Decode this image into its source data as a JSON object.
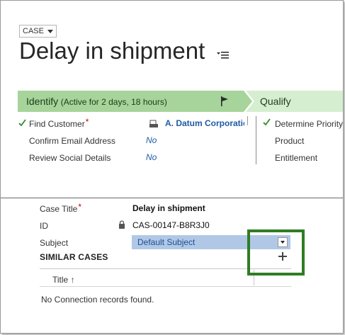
{
  "header": {
    "entity_label": "CASE",
    "title": "Delay in shipment"
  },
  "process": {
    "active_stage": "Identify",
    "active_note": "(Active for 2 days, 18 hours)",
    "next_stage": "Qualify",
    "steps_left": [
      {
        "label": "Find Customer",
        "required": true,
        "completed": true,
        "value": "A. Datum Corporatio",
        "value_style": "lookup"
      },
      {
        "label": "Confirm Email Address",
        "required": false,
        "completed": false,
        "value": "No",
        "value_style": "bool"
      },
      {
        "label": "Review Social Details",
        "required": false,
        "completed": false,
        "value": "No",
        "value_style": "bool"
      }
    ],
    "steps_right": [
      {
        "label": "Determine Priority",
        "completed": true
      },
      {
        "label": "Product",
        "completed": false
      },
      {
        "label": "Entitlement",
        "completed": false
      }
    ]
  },
  "form": {
    "case_title_label": "Case Title",
    "case_title_value": "Delay in shipment",
    "id_label": "ID",
    "id_value": "CAS-00147-B8R3J0",
    "subject_label": "Subject",
    "subject_value": "Default Subject"
  },
  "similar_cases": {
    "heading": "SIMILAR CASES",
    "column_title": "Title",
    "sort_indicator": "↑",
    "empty_message": "No Connection records found."
  },
  "colors": {
    "stage_active": "#a6d49a",
    "stage_next": "#d6eed0",
    "link": "#1f5aa6",
    "highlight": "#2f7d23",
    "subject_fill": "#b0c8e6"
  }
}
